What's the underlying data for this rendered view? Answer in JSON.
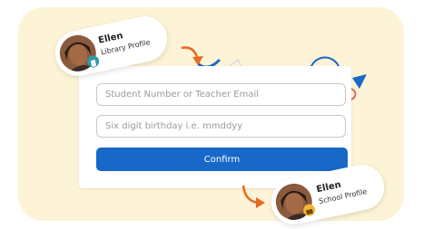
{
  "form": {
    "student_placeholder": "Student Number or Teacher Email",
    "birthday_placeholder": "Six digit birthday i.e. mmddyy",
    "confirm_label": "Confirm"
  },
  "library_profile": {
    "name": "Ellen",
    "subtitle": "Library Profile"
  },
  "school_profile": {
    "name": "Ellen",
    "subtitle": "School Profile"
  },
  "colors": {
    "background_panel": "#fdf3d6",
    "confirm_button": "#1868c9",
    "arrow": "#e8691e",
    "library_badge": "#2f9aa8",
    "school_badge": "#f2b632"
  }
}
